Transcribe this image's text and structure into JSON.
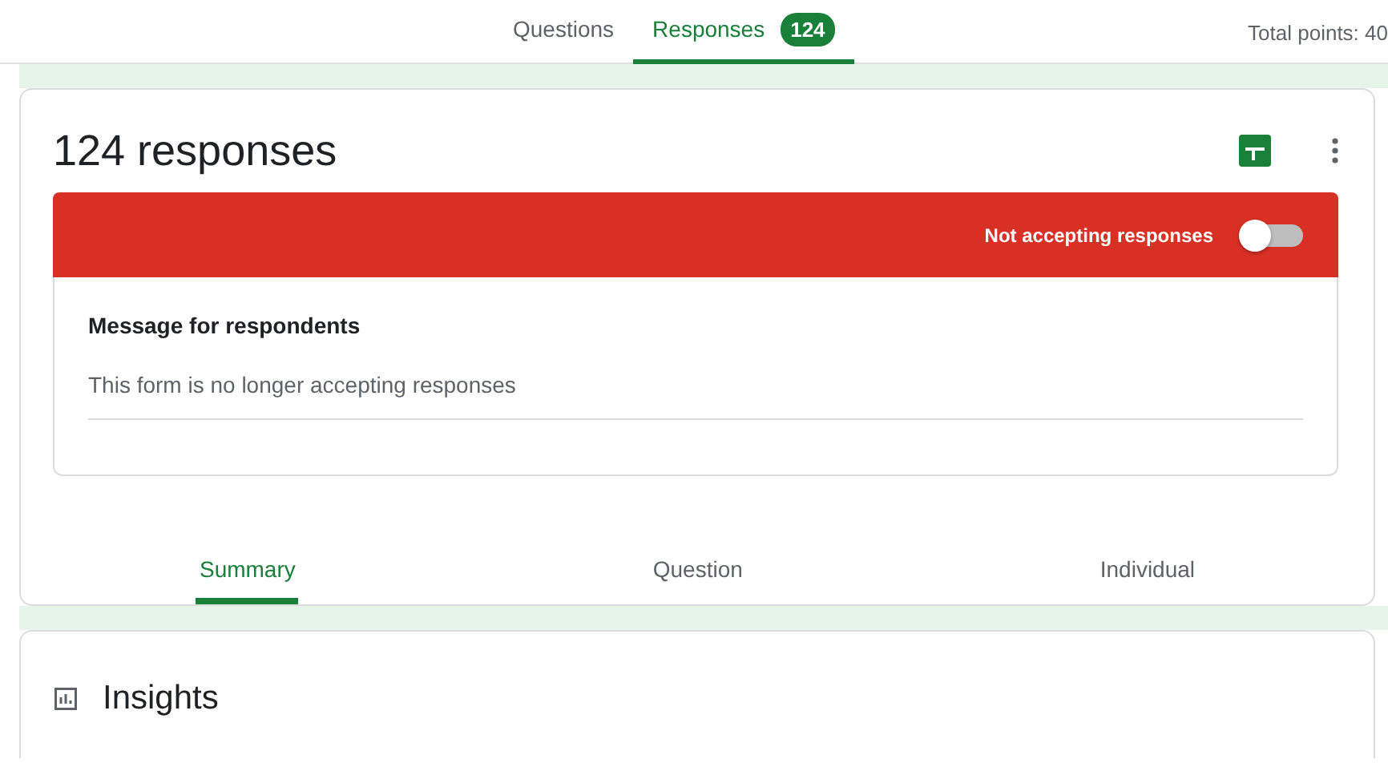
{
  "top_tabs": [
    {
      "label": "Questions",
      "selected": false
    },
    {
      "label": "Responses",
      "selected": true,
      "badge": "124"
    }
  ],
  "total_points": "Total points: 40",
  "responses_card": {
    "title": "124 responses",
    "accepting_label": "Not accepting responses",
    "accepting": false,
    "message_label": "Message for respondents",
    "message": "This form is no longer accepting responses"
  },
  "view_tabs": [
    {
      "label": "Summary",
      "selected": true
    },
    {
      "label": "Question",
      "selected": false
    },
    {
      "label": "Individual",
      "selected": false
    }
  ],
  "insights": {
    "title": "Insights"
  }
}
